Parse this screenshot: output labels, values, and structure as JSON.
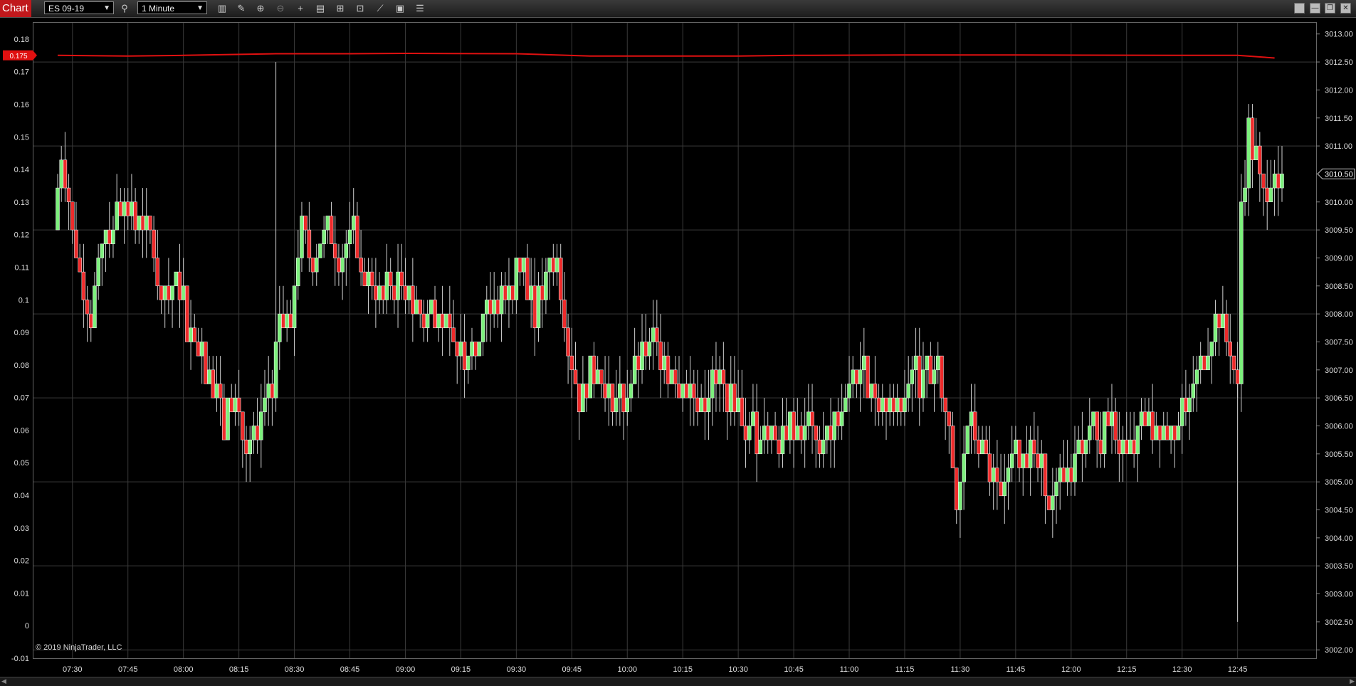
{
  "toolbar": {
    "tab_label": "Chart",
    "instrument": "ES 09-19",
    "interval": "1 Minute",
    "icons": [
      "search-icon",
      "bar-style-icon",
      "draw-icon",
      "zoom-in-icon",
      "zoom-out-icon",
      "crosshair-icon",
      "data-box-icon",
      "indicators-icon",
      "strategies-icon",
      "drawing-tools-icon",
      "properties-icon"
    ]
  },
  "window": {
    "minimize": "—",
    "restore": "❐",
    "close": "✕"
  },
  "copyright": "© 2019 NinjaTrader, LLC",
  "chart_data": {
    "type": "candlestick",
    "colors": {
      "up": "#7df07d",
      "down": "#ee2b2b",
      "indicator_line": "#e01010",
      "grid": "#3a3a3a",
      "marker_bg": "#e01010"
    },
    "x_tick_labels": [
      "07:30",
      "07:45",
      "08:00",
      "08:15",
      "08:30",
      "08:45",
      "09:00",
      "09:15",
      "09:30",
      "09:45",
      "10:00",
      "10:15",
      "10:30",
      "10:45",
      "11:00",
      "11:15",
      "11:30",
      "11:45",
      "12:00",
      "12:15",
      "12:30",
      "12:45"
    ],
    "left_axis": {
      "ylim": [
        -0.01,
        0.185
      ],
      "tick_labels": [
        "0.18",
        "0.17",
        "0.16",
        "0.15",
        "0.14",
        "0.13",
        "0.12",
        "0.11",
        "0.1",
        "0.09",
        "0.08",
        "0.07",
        "0.06",
        "0.05",
        "0.04",
        "0.03",
        "0.02",
        "0.01",
        "0",
        "-0.01"
      ],
      "tick_values": [
        0.18,
        0.17,
        0.16,
        0.15,
        0.14,
        0.13,
        0.12,
        0.11,
        0.1,
        0.09,
        0.08,
        0.07,
        0.06,
        0.05,
        0.04,
        0.03,
        0.02,
        0.01,
        0,
        -0.01
      ],
      "current_marker": "0.175",
      "current_value": 0.175
    },
    "right_axis": {
      "ylim": [
        3001.85,
        3013.2
      ],
      "tick_labels": [
        "3013.00",
        "3012.50",
        "3012.00",
        "3011.50",
        "3011.00",
        "3010.50",
        "3010.00",
        "3009.50",
        "3009.00",
        "3008.50",
        "3008.00",
        "3007.50",
        "3007.00",
        "3006.50",
        "3006.00",
        "3005.50",
        "3005.00",
        "3004.50",
        "3004.00",
        "3003.50",
        "3003.00",
        "3002.50",
        "3002.00"
      ],
      "tick_values": [
        3013.0,
        3012.5,
        3012.0,
        3011.5,
        3011.0,
        3010.5,
        3010.0,
        3009.5,
        3009.0,
        3008.5,
        3008.0,
        3007.5,
        3007.0,
        3006.5,
        3006.0,
        3005.5,
        3005.0,
        3004.5,
        3004.0,
        3003.5,
        3003.0,
        3002.5,
        3002.0
      ],
      "current_value": 3010.5
    },
    "indicator_line": [
      [
        "07:26",
        0.175
      ],
      [
        "07:45",
        0.1748
      ],
      [
        "08:00",
        0.175
      ],
      [
        "08:25",
        0.1755
      ],
      [
        "08:45",
        0.1755
      ],
      [
        "09:00",
        0.1756
      ],
      [
        "09:30",
        0.1755
      ],
      [
        "09:50",
        0.1748
      ],
      [
        "10:05",
        0.1748
      ],
      [
        "10:30",
        0.1748
      ],
      [
        "10:45",
        0.175
      ],
      [
        "11:15",
        0.1751
      ],
      [
        "11:45",
        0.1751
      ],
      [
        "12:30",
        0.175
      ],
      [
        "12:45",
        0.175
      ],
      [
        "12:55",
        0.1742
      ]
    ],
    "price_path": [
      [
        "07:26",
        3009.5
      ],
      [
        "07:28",
        3011.0
      ],
      [
        "07:31",
        3009.5
      ],
      [
        "07:34",
        3008.5
      ],
      [
        "07:36",
        3008.0
      ],
      [
        "07:38",
        3008.8
      ],
      [
        "07:41",
        3009.5
      ],
      [
        "07:45",
        3010.2
      ],
      [
        "07:48",
        3009.5
      ],
      [
        "07:52",
        3009.5
      ],
      [
        "07:55",
        3008.0
      ],
      [
        "07:58",
        3008.5
      ],
      [
        "08:02",
        3007.8
      ],
      [
        "08:05",
        3007.5
      ],
      [
        "08:08",
        3006.8
      ],
      [
        "08:12",
        3006.0
      ],
      [
        "08:15",
        3006.5
      ],
      [
        "08:18",
        3005.5
      ],
      [
        "08:22",
        3006.0
      ],
      [
        "08:25",
        3006.5
      ],
      [
        "08:27",
        3008.0
      ],
      [
        "08:30",
        3008.2
      ],
      [
        "08:33",
        3009.5
      ],
      [
        "08:36",
        3009.0
      ],
      [
        "08:40",
        3009.5
      ],
      [
        "08:43",
        3009.0
      ],
      [
        "08:47",
        3009.5
      ],
      [
        "08:50",
        3008.5
      ],
      [
        "08:55",
        3008.5
      ],
      [
        "09:00",
        3008.5
      ],
      [
        "09:05",
        3008.0
      ],
      [
        "09:10",
        3007.8
      ],
      [
        "09:15",
        3007.5
      ],
      [
        "09:18",
        3007.2
      ],
      [
        "09:22",
        3008.0
      ],
      [
        "09:26",
        3008.5
      ],
      [
        "09:32",
        3008.8
      ],
      [
        "09:36",
        3008.0
      ],
      [
        "09:40",
        3008.8
      ],
      [
        "09:43",
        3008.5
      ],
      [
        "09:45",
        3007.5
      ],
      [
        "09:48",
        3006.5
      ],
      [
        "09:52",
        3007.0
      ],
      [
        "09:57",
        3006.5
      ],
      [
        "10:00",
        3006.5
      ],
      [
        "10:04",
        3007.0
      ],
      [
        "10:08",
        3007.5
      ],
      [
        "10:12",
        3007.0
      ],
      [
        "10:15",
        3006.8
      ],
      [
        "10:20",
        3006.5
      ],
      [
        "10:26",
        3006.8
      ],
      [
        "10:30",
        3006.5
      ],
      [
        "10:35",
        3005.8
      ],
      [
        "10:40",
        3006.0
      ],
      [
        "10:45",
        3006.0
      ],
      [
        "10:50",
        3005.8
      ],
      [
        "10:56",
        3006.0
      ],
      [
        "11:00",
        3006.5
      ],
      [
        "11:05",
        3006.8
      ],
      [
        "11:10",
        3006.5
      ],
      [
        "11:15",
        3006.5
      ],
      [
        "11:20",
        3006.8
      ],
      [
        "11:24",
        3007.0
      ],
      [
        "11:27",
        3006.5
      ],
      [
        "11:30",
        3004.5
      ],
      [
        "11:33",
        3006.0
      ],
      [
        "11:37",
        3005.5
      ],
      [
        "11:41",
        3005.0
      ],
      [
        "11:45",
        3005.2
      ],
      [
        "11:50",
        3005.5
      ],
      [
        "11:55",
        3005.0
      ],
      [
        "12:00",
        3005.0
      ],
      [
        "12:04",
        3005.8
      ],
      [
        "12:08",
        3006.0
      ],
      [
        "12:12",
        3006.0
      ],
      [
        "12:16",
        3005.5
      ],
      [
        "12:20",
        3005.8
      ],
      [
        "12:25",
        3006.0
      ],
      [
        "12:30",
        3006.0
      ],
      [
        "12:33",
        3006.5
      ],
      [
        "12:36",
        3007.0
      ],
      [
        "12:40",
        3008.0
      ],
      [
        "12:44",
        3007.5
      ],
      [
        "12:46",
        3006.5
      ],
      [
        "12:47",
        3010.0
      ],
      [
        "12:49",
        3011.2
      ],
      [
        "12:51",
        3010.8
      ],
      [
        "12:53",
        3010.0
      ],
      [
        "12:55",
        3010.5
      ]
    ],
    "spikes": [
      {
        "time": "08:25",
        "high": 3012.5
      },
      {
        "time": "12:45",
        "low": 3002.5
      }
    ]
  }
}
